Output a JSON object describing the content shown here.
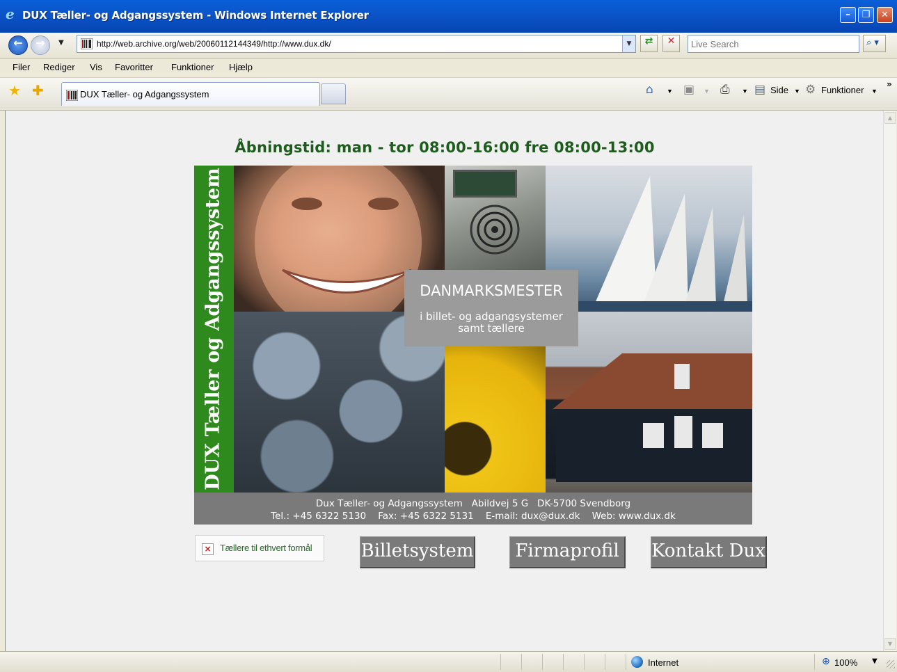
{
  "window": {
    "title": "DUX Tæller- og Adgangssystem - Windows Internet Explorer",
    "minimize": "–",
    "maximize": "❐",
    "close": "✕"
  },
  "addressbar": {
    "url": "http://web.archive.org/web/20060112144349/http://www.dux.dk/",
    "search_placeholder": "Live Search"
  },
  "menu": [
    "Filer",
    "Rediger",
    "Vis",
    "Favoritter",
    "Funktioner",
    "Hjælp"
  ],
  "tab": {
    "label": "DUX Tæller- og Adgangssystem"
  },
  "toolbar": {
    "side": "Side",
    "funktioner": "Funktioner",
    "more": "»"
  },
  "page": {
    "hours": "Åbningstid: man - tor 08:00-16:00 fre 08:00-13:00",
    "banner_vertical": "DUX Tæller og Adgangssystem",
    "caption_title": "DANMARKSMESTER",
    "caption_line1": "i billet- og adgangsystemer",
    "caption_line2": "samt tællere",
    "address_line1": "Dux Tæller- og Adgangssystem   Abildvej 5 G   DK-5700 Svendborg",
    "address_line2": "Tel.: +45 6322 5130    Fax: +45 6322 5131    E-mail: dux@dux.dk    Web: www.dux.dk",
    "broken_image_alt": "Tællere til ethvert formål",
    "nav": [
      "Billetsystem",
      "Firmaprofil",
      "Kontakt Dux"
    ]
  },
  "status": {
    "zone": "Internet",
    "zoom": "100%"
  },
  "colors": {
    "titlebar": "#0a54c8",
    "hours_text": "#1e5c1e",
    "banner_green": "#2f8a1e",
    "nav_bg": "#7a7a7a",
    "caption_bg": "#9b9b9b"
  }
}
